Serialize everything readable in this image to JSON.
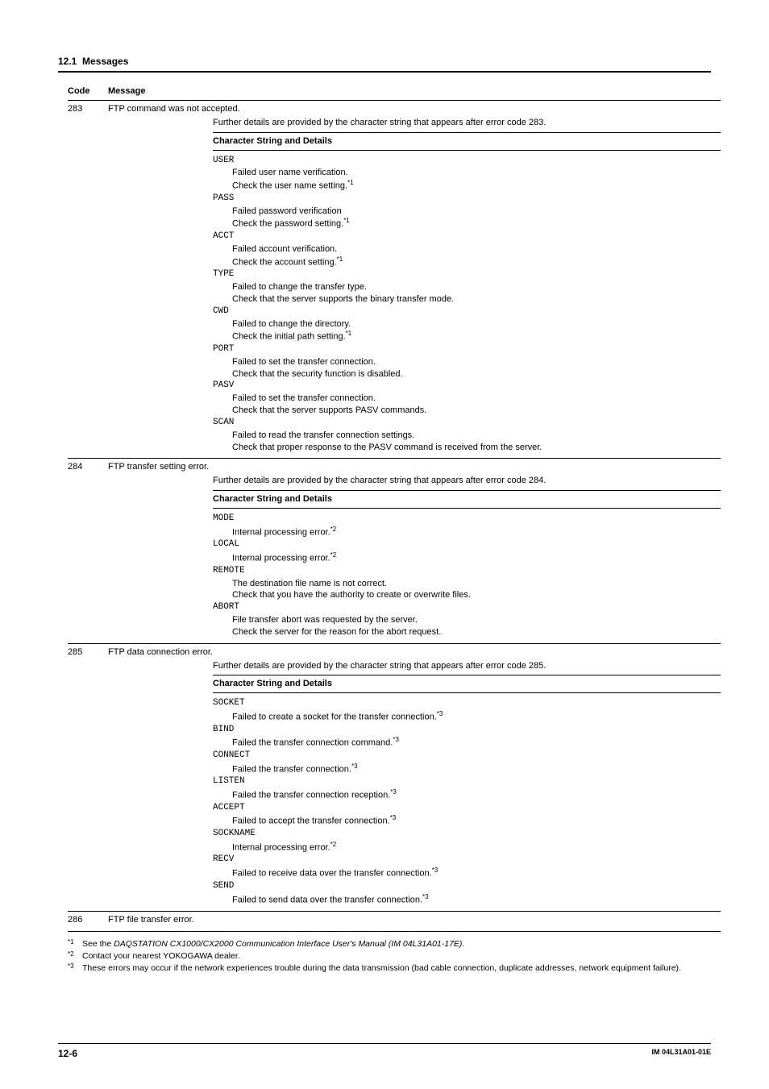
{
  "section_number": "12.1",
  "section_title": "Messages",
  "table": {
    "head": {
      "code": "Code",
      "message": "Message"
    },
    "rows": [
      {
        "code": "283",
        "message": "FTP command was not accepted.",
        "intro": "Further details are provided by the character string that appears after error code 283.",
        "subhead": "Character String and Details",
        "items": [
          {
            "cmd": "USER",
            "lines": [
              "Failed user name verification.",
              "Check the user name setting."
            ],
            "sup": "*1"
          },
          {
            "cmd": "PASS",
            "lines": [
              "Failed password verification",
              "Check the password setting."
            ],
            "sup": "*1"
          },
          {
            "cmd": "ACCT",
            "lines": [
              "Failed account verification.",
              "Check the account setting."
            ],
            "sup": "*1"
          },
          {
            "cmd": "TYPE",
            "lines": [
              "Failed to change the transfer type.",
              "Check that the server supports the binary transfer mode."
            ]
          },
          {
            "cmd": "CWD",
            "lines": [
              "Failed to change the directory.",
              "Check the initial path setting."
            ],
            "sup": "*1"
          },
          {
            "cmd": "PORT",
            "lines": [
              "Failed to set the transfer connection.",
              "Check that the security function is disabled."
            ]
          },
          {
            "cmd": "PASV",
            "lines": [
              "Failed to set the transfer connection.",
              "Check that the server supports PASV commands."
            ]
          },
          {
            "cmd": "SCAN",
            "lines": [
              "Failed to read the transfer connection settings.",
              "Check that proper response to the PASV command is received from the server."
            ]
          }
        ]
      },
      {
        "code": "284",
        "message": "FTP transfer setting error.",
        "intro": "Further details are provided by the character string that appears after error code 284.",
        "subhead": "Character String and Details",
        "items": [
          {
            "cmd": "MODE",
            "lines": [
              "Internal processing error."
            ],
            "sup": "*2"
          },
          {
            "cmd": "LOCAL",
            "lines": [
              "Internal processing error."
            ],
            "sup": "*2"
          },
          {
            "cmd": "REMOTE",
            "lines": [
              "The destination file name is not correct.",
              "Check that you have the authority to create or overwrite files."
            ]
          },
          {
            "cmd": "ABORT",
            "lines": [
              "File transfer abort was requested by the server.",
              "Check the server for the reason for the abort request."
            ]
          }
        ]
      },
      {
        "code": "285",
        "message": "FTP data connection error.",
        "intro": "Further details are provided by the character string that appears after error code 285.",
        "subhead": "Character String and Details",
        "items": [
          {
            "cmd": "SOCKET",
            "lines": [
              "Failed to create a socket for the transfer connection."
            ],
            "sup": "*3"
          },
          {
            "cmd": "BIND",
            "lines": [
              "Failed the transfer connection command."
            ],
            "sup": "*3"
          },
          {
            "cmd": "CONNECT",
            "lines": [
              "Failed the transfer connection."
            ],
            "sup": "*3"
          },
          {
            "cmd": "LISTEN",
            "lines": [
              "Failed the transfer connection reception."
            ],
            "sup": "*3"
          },
          {
            "cmd": "ACCEPT",
            "lines": [
              "Failed to accept the transfer connection."
            ],
            "sup": "*3"
          },
          {
            "cmd": "SOCKNAME",
            "lines": [
              "Internal processing error."
            ],
            "sup": "*2"
          },
          {
            "cmd": "RECV",
            "lines": [
              "Failed to receive data over the transfer connection."
            ],
            "sup": "*3"
          },
          {
            "cmd": "SEND",
            "lines": [
              "Failed to send data over the transfer connection."
            ],
            "sup": "*3"
          }
        ]
      },
      {
        "code": "286",
        "message": "FTP file transfer error."
      }
    ]
  },
  "footnotes": [
    {
      "sup": "*1",
      "text_before": "See the ",
      "italic": "DAQSTATION CX1000/CX2000 Communication Interface User's Manual (IM 04L31A01-17E)",
      "text_after": "."
    },
    {
      "sup": "*2",
      "text_before": "Contact your nearest YOKOGAWA dealer.",
      "italic": "",
      "text_after": ""
    },
    {
      "sup": "*3",
      "text_before": "These errors may occur if the network experiences trouble during the data transmission (bad cable connection, duplicate addresses, network equipment failure).",
      "italic": "",
      "text_after": ""
    }
  ],
  "footer": {
    "page": "12-6",
    "docid": "IM 04L31A01-01E"
  }
}
